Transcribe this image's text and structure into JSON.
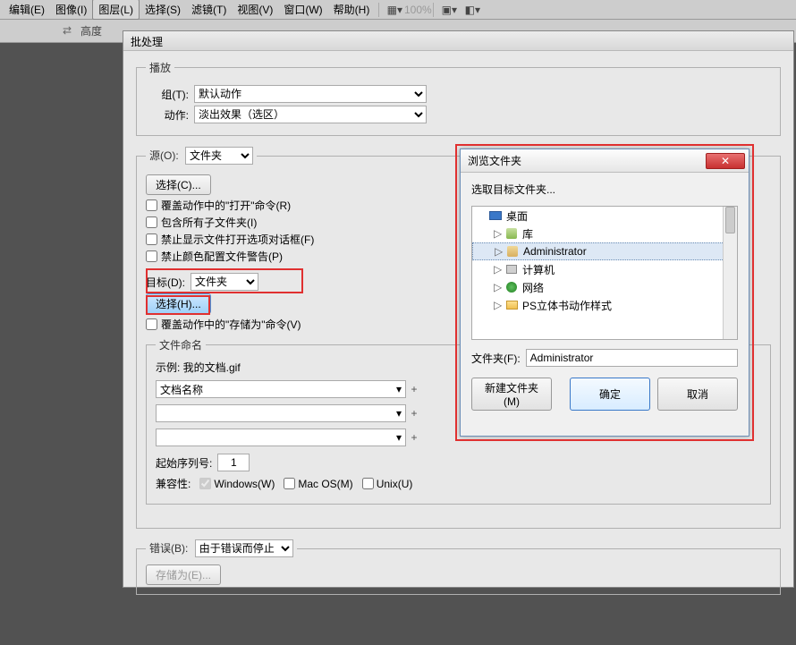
{
  "menubar": {
    "items": [
      "编辑(E)",
      "图像(I)",
      "图层(L)",
      "选择(S)",
      "滤镜(T)",
      "视图(V)",
      "窗口(W)",
      "帮助(H)"
    ],
    "active_index": 2,
    "zoom": "100%"
  },
  "optbar": {
    "height_label": "高度"
  },
  "batch": {
    "title": "批处理",
    "play": {
      "legend": "播放",
      "group_label": "组(T):",
      "group_value": "默认动作",
      "action_label": "动作:",
      "action_value": "淡出效果（选区）"
    },
    "source": {
      "legend_prefix": "源(O):",
      "type": "文件夹",
      "choose_btn": "选择(C)...",
      "checks": [
        "覆盖动作中的\"打开\"命令(R)",
        "包含所有子文件夹(I)",
        "禁止显示文件打开选项对话框(F)",
        "禁止颜色配置文件警告(P)"
      ],
      "target_label": "目标(D):",
      "target_value": "文件夹",
      "select_btn": "选择(H)...",
      "override_save": "覆盖动作中的\"存储为\"命令(V)",
      "filename_legend": "文件命名",
      "example": "示例: 我的文档.gif",
      "name_field": "文档名称",
      "start_seq_label": "起始序列号:",
      "start_seq_value": "1",
      "compat_label": "兼容性:",
      "compat_windows": "Windows(W)",
      "compat_mac": "Mac OS(M)",
      "compat_unix": "Unix(U)"
    },
    "errors": {
      "label": "错误(B):",
      "value": "由于错误而停止",
      "save_as": "存储为(E)..."
    }
  },
  "browse": {
    "title": "浏览文件夹",
    "prompt": "选取目标文件夹...",
    "tree": [
      {
        "icon": "monitor",
        "label": "桌面",
        "depth": 0,
        "expander": ""
      },
      {
        "icon": "lib",
        "label": "库",
        "depth": 1,
        "expander": "▷"
      },
      {
        "icon": "user",
        "label": "Administrator",
        "depth": 1,
        "expander": "▷",
        "selected": true
      },
      {
        "icon": "computer",
        "label": "计算机",
        "depth": 1,
        "expander": "▷"
      },
      {
        "icon": "network",
        "label": "网络",
        "depth": 1,
        "expander": "▷"
      },
      {
        "icon": "folder",
        "label": "PS立体书动作样式",
        "depth": 1,
        "expander": "▷"
      }
    ],
    "folder_label": "文件夹(F):",
    "folder_value": "Administrator",
    "new_folder": "新建文件夹 (M)",
    "ok": "确定",
    "cancel": "取消"
  }
}
